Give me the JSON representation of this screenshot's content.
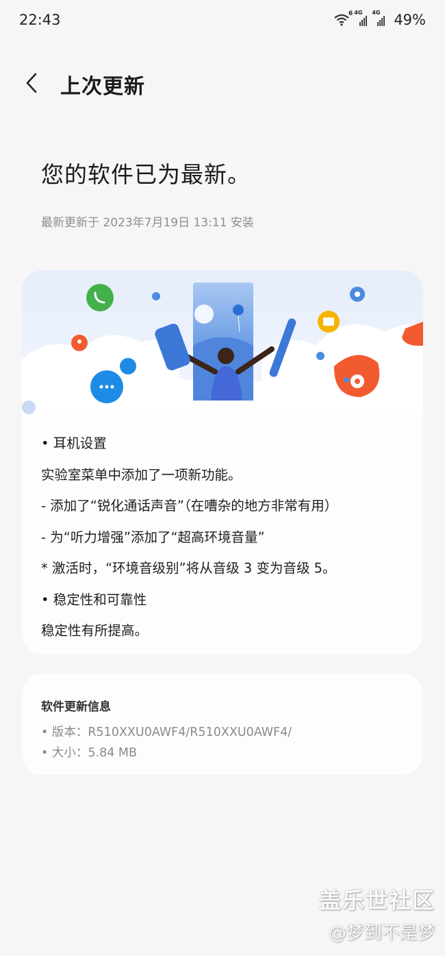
{
  "status_bar": {
    "time": "22:43",
    "wifi_badge": "6",
    "sim1_label": "4G",
    "sim2_label": "4G",
    "battery": "49%"
  },
  "header": {
    "back_icon": "chevron-left-icon",
    "title": "上次更新"
  },
  "main": {
    "status_title": "您的软件已为最新。",
    "last_update": "最新更新于 2023年7月19日 13:11 安装"
  },
  "notes": {
    "lines": [
      "• 耳机设置",
      "实验室菜单中添加了一项新功能。",
      "- 添加了“锐化通话声音”（在嘈杂的地方非常有用）",
      "- 为“听力增强”添加了“超高环境音量”",
      "* 激活时，“环境音级别”将从音级 3 变为音级 5。",
      "• 稳定性和可靠性",
      "稳定性有所提高。"
    ]
  },
  "info": {
    "title": "软件更新信息",
    "version": "• 版本：R510XXU0AWF4/R510XXU0AWF4/",
    "size": "• 大小：5.84 MB"
  },
  "watermark": {
    "title": "盖乐世社区",
    "author": "@梦到不是梦"
  },
  "colors": {
    "background": "#f6f6f6",
    "card": "#fdfdfd",
    "secondary_text": "#8d8d8d",
    "illustration_green": "#43b04a",
    "illustration_blue": "#1e8ce6",
    "illustration_orange": "#f25a30",
    "illustration_yellow": "#f5b400",
    "illustration_panel": "#3c78d8"
  }
}
